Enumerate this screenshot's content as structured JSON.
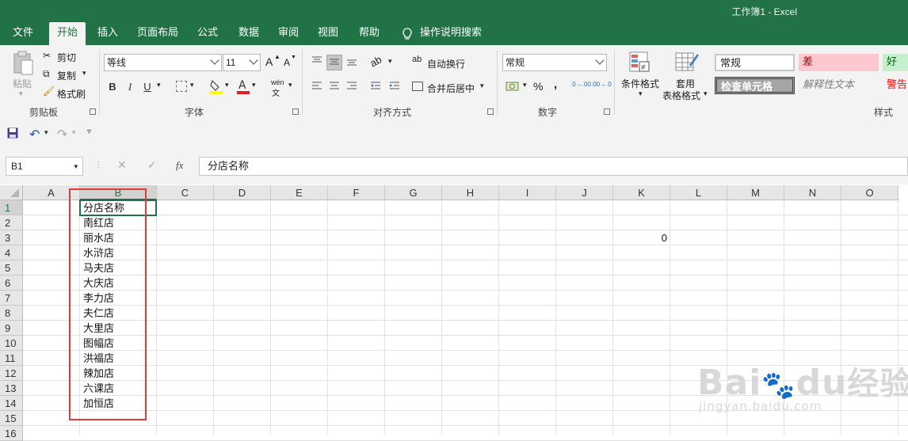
{
  "window": {
    "title": "工作簿1  -  Excel"
  },
  "tabs": [
    "文件",
    "开始",
    "插入",
    "页面布局",
    "公式",
    "数据",
    "审阅",
    "视图",
    "帮助"
  ],
  "tell_me": "操作说明搜索",
  "ribbon": {
    "clipboard": {
      "paste": "粘贴",
      "cut": "剪切",
      "copy": "复制",
      "format_painter": "格式刷",
      "label": "剪贴板"
    },
    "font": {
      "font_name": "等线",
      "font_size": "11",
      "label": "字体",
      "bold": "B",
      "italic": "I",
      "underline": "U",
      "grow": "A",
      "shrink": "A",
      "phonetic": "wén"
    },
    "alignment": {
      "wrap_text": "自动换行",
      "merge_center": "合并后居中",
      "label": "对齐方式"
    },
    "number": {
      "format": "常规",
      "percent": "%",
      "comma": ",",
      "label": "数字",
      "inc_decimal": ".0→.00",
      "dec_decimal": ".00→.0"
    },
    "styles": {
      "conditional_formatting": "条件格式",
      "format_as_table_1": "套用",
      "format_as_table_2": "表格格式",
      "normal": "常规",
      "bad": "差",
      "good": "好",
      "check_cell": "检查单元格",
      "explanatory": "解释性文本",
      "warning": "警告",
      "label": "样式"
    }
  },
  "formula_bar": {
    "name_box": "B1",
    "fx": "fx",
    "content": "分店名称"
  },
  "columns": [
    "A",
    "B",
    "C",
    "D",
    "E",
    "F",
    "G",
    "H",
    "I",
    "J",
    "K",
    "L",
    "M",
    "N",
    "O"
  ],
  "rows": [
    "1",
    "2",
    "3",
    "4",
    "5",
    "6",
    "7",
    "8",
    "9",
    "10",
    "11",
    "12",
    "13",
    "14",
    "15",
    "16"
  ],
  "cells": {
    "B": [
      "分店名称",
      "南红店",
      "丽水店",
      "水浒店",
      "马夫店",
      "大庆店",
      "李力店",
      "夫仁店",
      "大里店",
      "图幅店",
      "洪福店",
      "辣加店",
      "六课店",
      "加恒店"
    ],
    "K3": "0"
  },
  "watermark": {
    "brand": "Bai",
    "brand2": "du",
    "cn": "经验",
    "url": "jingyan.baidu.com"
  },
  "colors": {
    "excel_green": "#217346",
    "highlight_red": "#e03a3a",
    "bad_fill": "#ffc7ce",
    "good_fill": "#c6efce"
  }
}
